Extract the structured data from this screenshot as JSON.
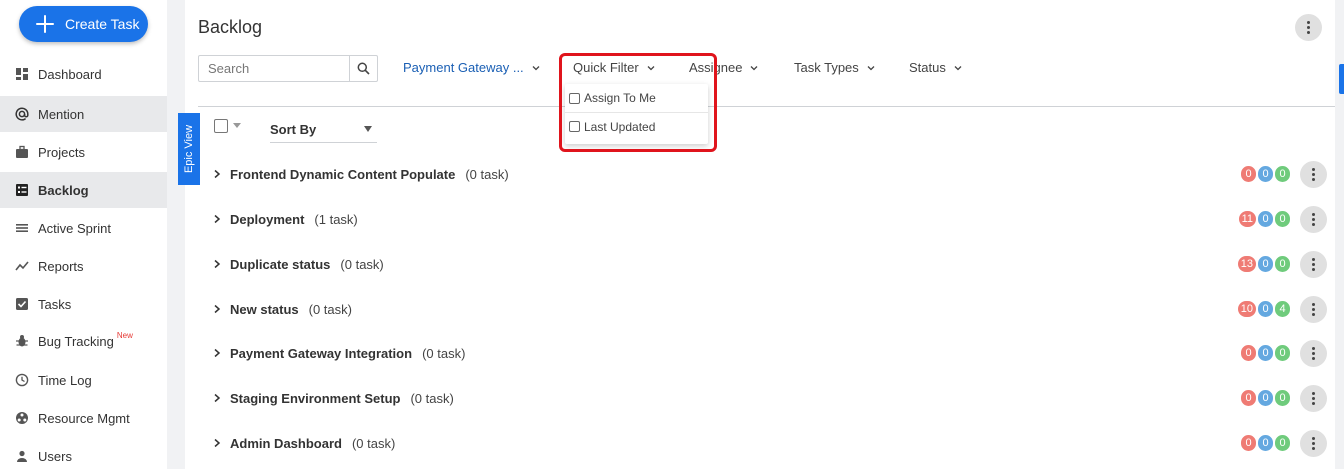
{
  "sidebar": {
    "create_button": "Create Task",
    "items": [
      {
        "label": "Dashboard",
        "icon": "dashboard-icon"
      },
      {
        "label": "Mention",
        "icon": "at-icon"
      },
      {
        "label": "Projects",
        "icon": "briefcase-icon"
      },
      {
        "label": "Backlog",
        "icon": "backlog-icon"
      },
      {
        "label": "Active Sprint",
        "icon": "sprint-icon"
      },
      {
        "label": "Reports",
        "icon": "chart-line-icon"
      },
      {
        "label": "Tasks",
        "icon": "checkbox-icon"
      },
      {
        "label": "Bug Tracking",
        "icon": "bug-icon",
        "tag": "New"
      },
      {
        "label": "Time Log",
        "icon": "clock-icon"
      },
      {
        "label": "Resource Mgmt",
        "icon": "resource-icon"
      },
      {
        "label": "Users",
        "icon": "user-icon"
      }
    ]
  },
  "header": {
    "title": "Backlog"
  },
  "search": {
    "placeholder": "Search",
    "value": ""
  },
  "filters": {
    "project": "Payment Gateway ...",
    "quick_filter": "Quick Filter",
    "assignee": "Assignee",
    "task_types": "Task Types",
    "status": "Status"
  },
  "quick_filter_menu": {
    "options": [
      "Assign To Me",
      "Last Updated"
    ]
  },
  "toolbar": {
    "epic_view": "Epic View",
    "sort_by": "Sort By"
  },
  "epics": [
    {
      "name": "Frontend Dynamic Content Populate",
      "count": "(0 task)",
      "badges": [
        "0",
        "0",
        "0"
      ]
    },
    {
      "name": "Deployment",
      "count": "(1 task)",
      "badges": [
        "11",
        "0",
        "0"
      ]
    },
    {
      "name": "Duplicate status",
      "count": "(0 task)",
      "badges": [
        "13",
        "0",
        "0"
      ]
    },
    {
      "name": "New status",
      "count": "(0 task)",
      "badges": [
        "10",
        "0",
        "4"
      ]
    },
    {
      "name": "Payment Gateway Integration",
      "count": "(0 task)",
      "badges": [
        "0",
        "0",
        "0"
      ]
    },
    {
      "name": "Staging Environment Setup",
      "count": "(0 task)",
      "badges": [
        "0",
        "0",
        "0"
      ]
    },
    {
      "name": "Admin Dashboard",
      "count": "(0 task)",
      "badges": [
        "0",
        "0",
        "0"
      ]
    }
  ],
  "colors": {
    "primary": "#1a73e8",
    "highlight": "#e0141c",
    "badge_red": "#ef7b74",
    "badge_blue": "#64a8e0",
    "badge_green": "#6fcb7c"
  }
}
